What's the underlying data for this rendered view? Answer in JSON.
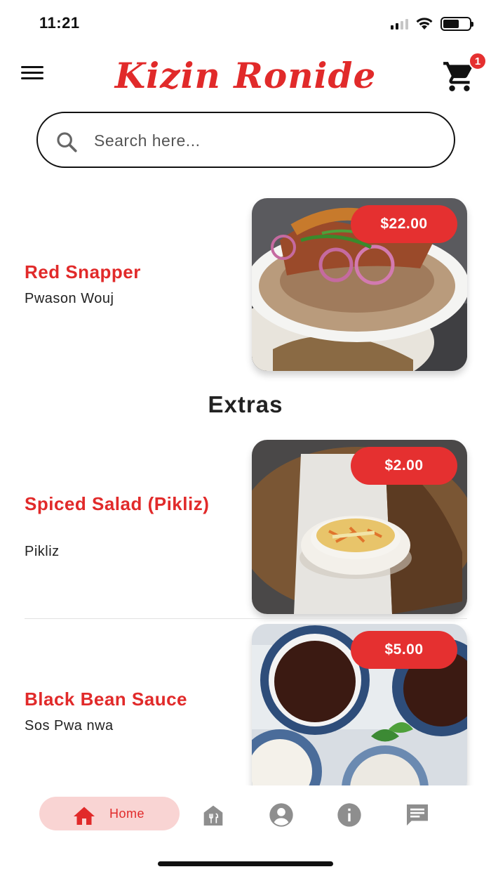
{
  "status_bar": {
    "time": "11:21"
  },
  "header": {
    "brand": "Kizin Ronide",
    "cart_badge": "1",
    "icons": {
      "menu": "hamburger-menu-icon",
      "cart": "shopping-cart-icon"
    }
  },
  "search": {
    "placeholder": "Search here...",
    "value": ""
  },
  "items": [
    {
      "name": "Red Snapper",
      "subtitle": "Pwason Wouj",
      "price": "$22.00",
      "image": "red-snapper-with-rice"
    },
    {
      "name": "Spiced Salad (Pikliz)",
      "subtitle": "Pikliz",
      "price": "$2.00",
      "image": "pikliz-bowl"
    },
    {
      "name": "Black Bean Sauce",
      "subtitle": "Sos Pwa nwa",
      "price": "$5.00",
      "image": "black-bean-sauce-bowls"
    }
  ],
  "sections": {
    "extras_title": "Extras"
  },
  "bottom_nav": {
    "home_label": "Home",
    "icons": [
      "home-icon",
      "restaurant-icon",
      "profile-icon",
      "info-icon",
      "chat-icon"
    ]
  },
  "colors": {
    "accent": "#e12a2a",
    "accent_soft": "#f9d4d3",
    "price_pill": "#e53030"
  }
}
